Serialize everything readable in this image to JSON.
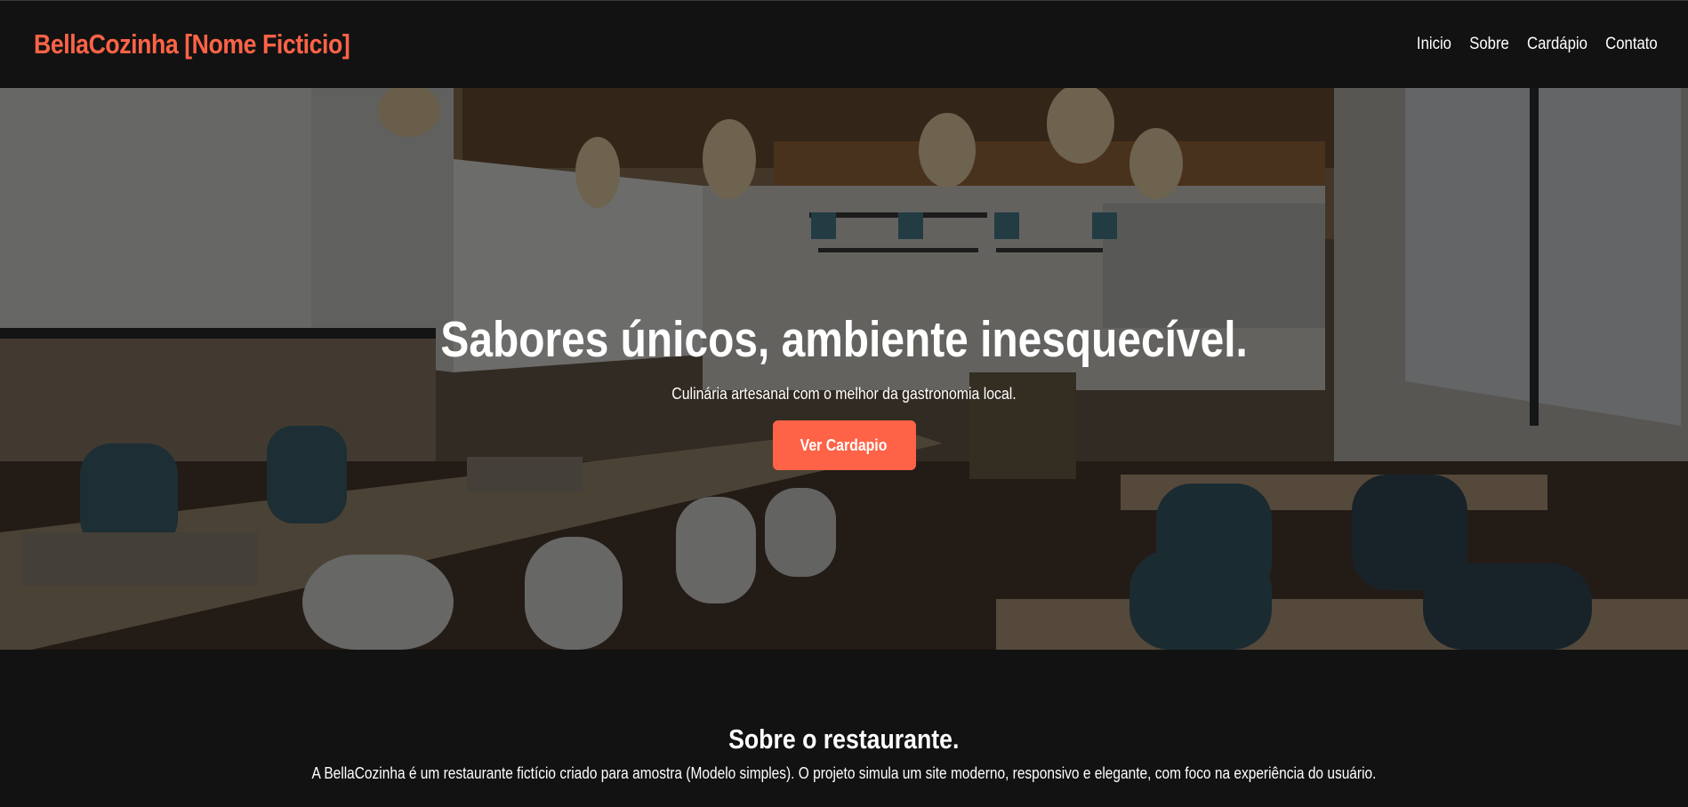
{
  "navbar": {
    "brand": "BellaCozinha [Nome Ficticio]",
    "links": [
      "Inicio",
      "Sobre",
      "Cardápio",
      "Contato"
    ]
  },
  "hero": {
    "title": "Sabores únicos, ambiente inesquecível.",
    "subtitle": "Culinária artesanal com o melhor da gastronomia local.",
    "button_label": "Ver Cardapio",
    "background_image": "restaurant-interior-photo"
  },
  "about": {
    "title": "Sobre o restaurante.",
    "text": "A BellaCozinha é um restaurante fictício criado para amostra (Modelo simples). O projeto simula um site moderno, responsivo e elegante, com foco na experiência do usuário."
  },
  "colors": {
    "accent": "#ff6347",
    "background": "#121212",
    "text": "#ffffff"
  }
}
